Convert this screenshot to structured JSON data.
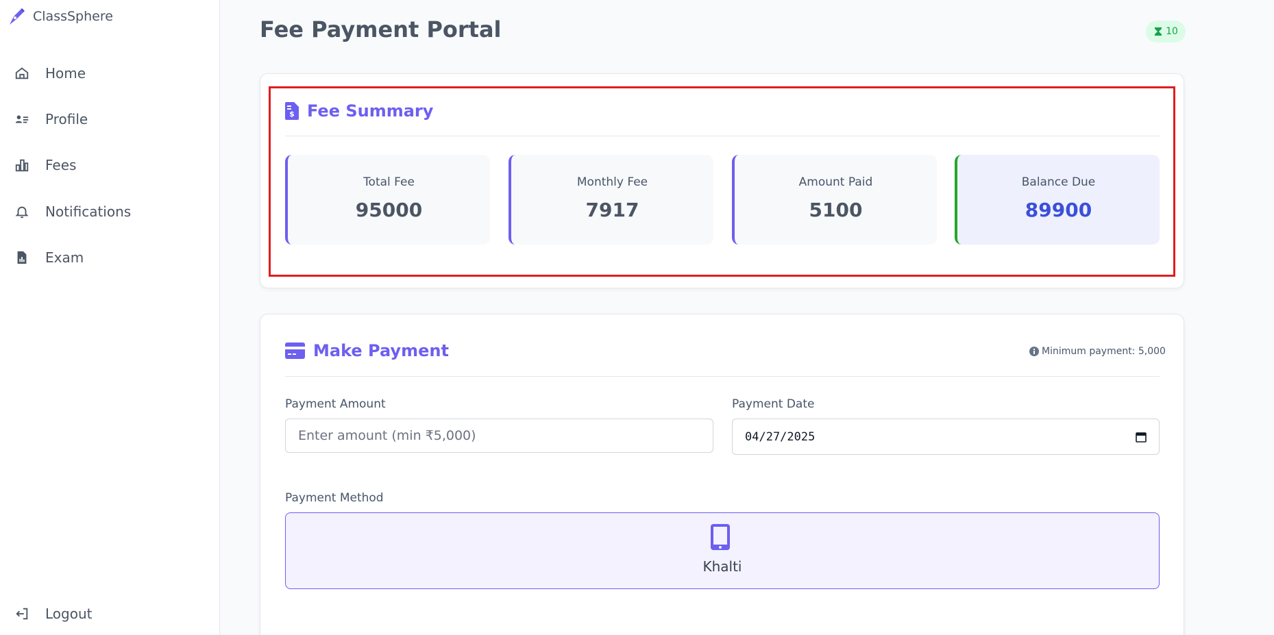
{
  "app": {
    "name": "ClassSphere"
  },
  "sidebar": {
    "items": [
      {
        "label": "Home",
        "icon": "home-icon"
      },
      {
        "label": "Profile",
        "icon": "profile-icon"
      },
      {
        "label": "Fees",
        "icon": "bar-chart-icon"
      },
      {
        "label": "Notifications",
        "icon": "bell-icon"
      },
      {
        "label": "Exam",
        "icon": "document-chart-icon"
      }
    ],
    "logout": "Logout"
  },
  "header": {
    "title": "Fee Payment Portal",
    "badge": "10"
  },
  "summary": {
    "title": "Fee Summary",
    "stats": [
      {
        "label": "Total Fee",
        "value": "95000"
      },
      {
        "label": "Monthly Fee",
        "value": "7917"
      },
      {
        "label": "Amount Paid",
        "value": "5100"
      },
      {
        "label": "Balance Due",
        "value": "89900"
      }
    ]
  },
  "payment": {
    "title": "Make Payment",
    "min_note": "Minimum payment: 5,000",
    "amount_label": "Payment Amount",
    "amount_placeholder": "Enter amount (min ₹5,000)",
    "date_label": "Payment Date",
    "date_value": "04/27/2025",
    "method_label": "Payment Method",
    "method_name": "Khalti"
  },
  "colors": {
    "accent": "#6d5ff0",
    "success": "#22a82a",
    "highlight": "#e11d1d"
  }
}
